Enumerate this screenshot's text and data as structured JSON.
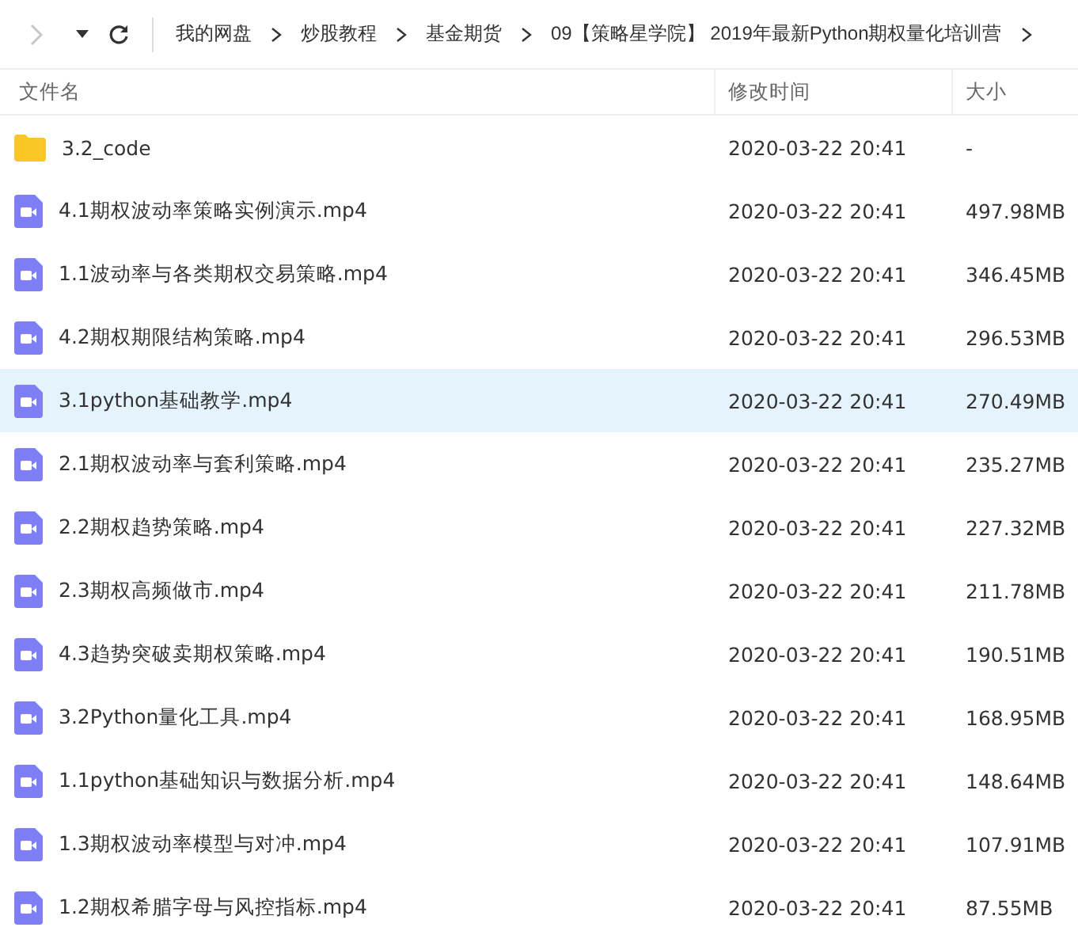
{
  "nav": {
    "back_disabled": true
  },
  "breadcrumb": [
    "我的网盘",
    "炒股教程",
    "基金期货",
    "09【策略星学院】 2019年最新Python期权量化培训营"
  ],
  "columns": [
    "文件名",
    "修改时间",
    "大小"
  ],
  "files": [
    {
      "kind": "folder",
      "name": "3.2_code",
      "modified": "2020-03-22 20:41",
      "size": "-",
      "selected": false
    },
    {
      "kind": "video",
      "name": "4.1期权波动率策略实例演示.mp4",
      "modified": "2020-03-22 20:41",
      "size": "497.98MB",
      "selected": false
    },
    {
      "kind": "video",
      "name": "1.1波动率与各类期权交易策略.mp4",
      "modified": "2020-03-22 20:41",
      "size": "346.45MB",
      "selected": false
    },
    {
      "kind": "video",
      "name": "4.2期权期限结构策略.mp4",
      "modified": "2020-03-22 20:41",
      "size": "296.53MB",
      "selected": false
    },
    {
      "kind": "video",
      "name": "3.1python基础教学.mp4",
      "modified": "2020-03-22 20:41",
      "size": "270.49MB",
      "selected": true
    },
    {
      "kind": "video",
      "name": "2.1期权波动率与套利策略.mp4",
      "modified": "2020-03-22 20:41",
      "size": "235.27MB",
      "selected": false
    },
    {
      "kind": "video",
      "name": "2.2期权趋势策略.mp4",
      "modified": "2020-03-22 20:41",
      "size": "227.32MB",
      "selected": false
    },
    {
      "kind": "video",
      "name": "2.3期权高频做市.mp4",
      "modified": "2020-03-22 20:41",
      "size": "211.78MB",
      "selected": false
    },
    {
      "kind": "video",
      "name": "4.3趋势突破卖期权策略.mp4",
      "modified": "2020-03-22 20:41",
      "size": "190.51MB",
      "selected": false
    },
    {
      "kind": "video",
      "name": "3.2Python量化工具.mp4",
      "modified": "2020-03-22 20:41",
      "size": "168.95MB",
      "selected": false
    },
    {
      "kind": "video",
      "name": "1.1python基础知识与数据分析.mp4",
      "modified": "2020-03-22 20:41",
      "size": "148.64MB",
      "selected": false
    },
    {
      "kind": "video",
      "name": "1.3期权波动率模型与对冲.mp4",
      "modified": "2020-03-22 20:41",
      "size": "107.91MB",
      "selected": false
    },
    {
      "kind": "video",
      "name": "1.2期权希腊字母与风控指标.mp4",
      "modified": "2020-03-22 20:41",
      "size": "87.55MB",
      "selected": false
    }
  ]
}
